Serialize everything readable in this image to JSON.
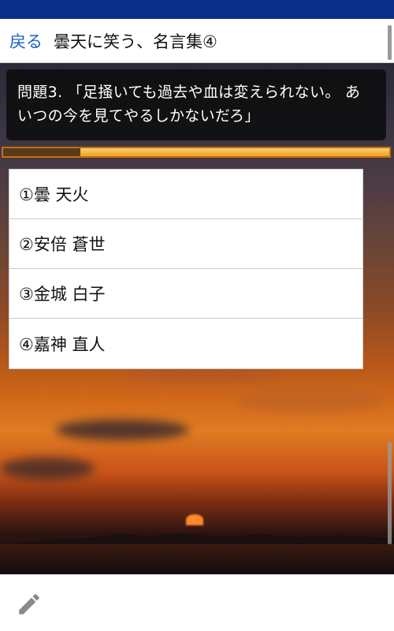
{
  "header": {
    "back_label": "戻る",
    "title": "曇天に笑う、名言集④"
  },
  "question": {
    "text": "問題3. 「足掻いても過去や血は変えられない。 あいつの今を見てやるしかないだろ」",
    "progress_fraction": 0.2
  },
  "answers": [
    {
      "label": "①曇 天火"
    },
    {
      "label": "②安倍 蒼世"
    },
    {
      "label": "③金城 白子"
    },
    {
      "label": "④嘉神 直人"
    }
  ],
  "footer": {
    "icon": "pencil-icon"
  },
  "colors": {
    "status_bar": "#0a2f8a",
    "back_link": "#1a5fc4",
    "progress": "#f0a020"
  }
}
